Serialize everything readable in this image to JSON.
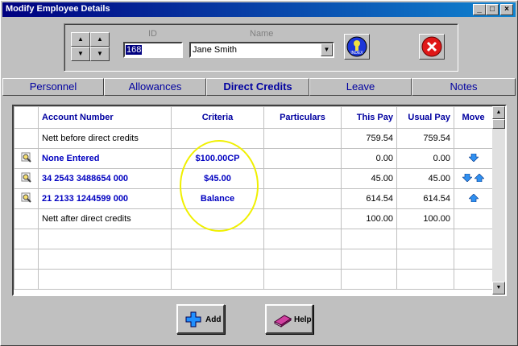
{
  "window": {
    "title": "Modify Employee Details"
  },
  "titlebar_buttons": {
    "min": "_",
    "max": "□",
    "close": "×"
  },
  "header": {
    "id_label": "ID",
    "id_value": "168",
    "name_label": "Name",
    "name_value": "Jane Smith",
    "index_icon": "index-icon",
    "close_icon": "red-x-icon"
  },
  "tabs": [
    {
      "label": "Personnel"
    },
    {
      "label": "Allowances"
    },
    {
      "label": "Direct Credits",
      "active": true
    },
    {
      "label": "Leave"
    },
    {
      "label": "Notes"
    }
  ],
  "grid": {
    "columns": [
      "",
      "Account Number",
      "Criteria",
      "Particulars",
      "This Pay",
      "Usual Pay",
      "Move"
    ],
    "rows": [
      {
        "icon": "",
        "account": "Nett before direct credits",
        "criteria": "",
        "particulars": "",
        "this_pay": "759.54",
        "usual_pay": "759.54",
        "move": "",
        "bold": false
      },
      {
        "icon": "magnifier-icon",
        "account": "None Entered",
        "criteria": "$100.00CP",
        "particulars": "",
        "this_pay": "0.00",
        "usual_pay": "0.00",
        "move": "down",
        "bold": true
      },
      {
        "icon": "magnifier-icon",
        "account": "34 2543 3488654 000",
        "criteria": "$45.00",
        "particulars": "",
        "this_pay": "45.00",
        "usual_pay": "45.00",
        "move": "both",
        "bold": true
      },
      {
        "icon": "magnifier-icon",
        "account": "21 2133 1244599 000",
        "criteria": "Balance",
        "particulars": "",
        "this_pay": "614.54",
        "usual_pay": "614.54",
        "move": "up",
        "bold": true
      },
      {
        "icon": "",
        "account": "Nett after direct credits",
        "criteria": "",
        "particulars": "",
        "this_pay": "100.00",
        "usual_pay": "100.00",
        "move": "",
        "bold": false
      },
      {
        "icon": "",
        "account": "",
        "criteria": "",
        "particulars": "",
        "this_pay": "",
        "usual_pay": "",
        "move": "",
        "bold": false
      },
      {
        "icon": "",
        "account": "",
        "criteria": "",
        "particulars": "",
        "this_pay": "",
        "usual_pay": "",
        "move": "",
        "bold": false
      },
      {
        "icon": "",
        "account": "",
        "criteria": "",
        "particulars": "",
        "this_pay": "",
        "usual_pay": "",
        "move": "",
        "bold": false
      }
    ]
  },
  "buttons": {
    "add": "Add",
    "help": "Help"
  },
  "colors": {
    "accent": "#0000a0",
    "highlight": "#f0f000"
  }
}
